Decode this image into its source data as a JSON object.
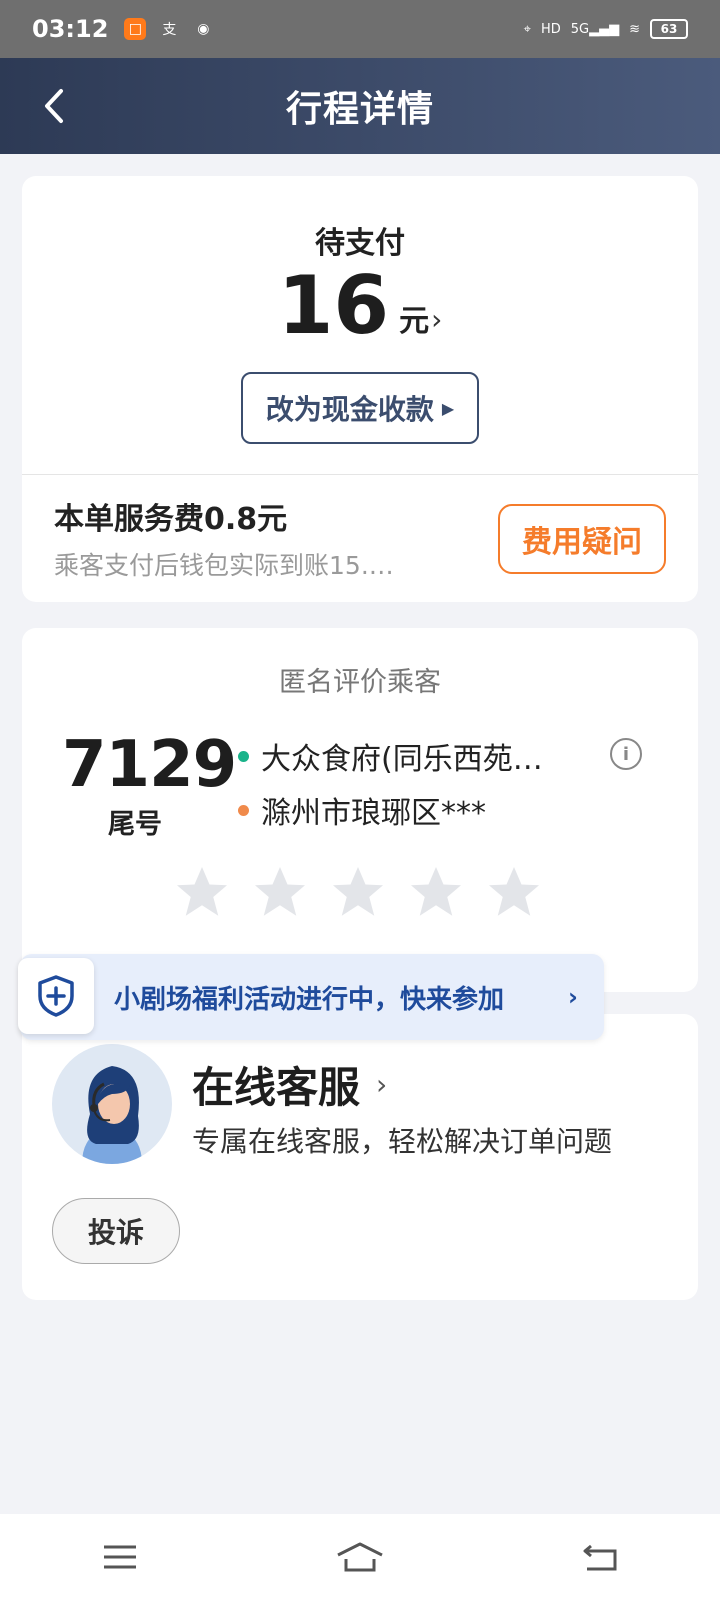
{
  "status_bar": {
    "time": "03:12",
    "left_icons": [
      "orange-app-icon",
      "alipay-icon",
      "chat-icon"
    ],
    "network": "5G",
    "hd": "HD",
    "battery": "63"
  },
  "header": {
    "title": "行程详情"
  },
  "payment": {
    "status": "待支付",
    "amount": "16",
    "unit": "元",
    "cash_button": "改为现金收款",
    "fee_title": "本单服务费0.8元",
    "fee_subtitle": "乘客支付后钱包实际到账15.…",
    "fee_question_button": "费用疑问"
  },
  "rating": {
    "title": "匿名评价乘客",
    "tail_number": "7129",
    "tail_label": "尾号",
    "from": "大众食府(同乐西苑…",
    "to": "滁州市琅琊区***",
    "stars_selected": 0,
    "stars_total": 5
  },
  "promo": {
    "text": "小剧场福利活动进行中，快来参加"
  },
  "service": {
    "title": "在线客服",
    "subtitle": "专属在线客服，轻松解决订单问题",
    "complain_button": "投诉"
  },
  "colors": {
    "accent_orange": "#f57c2b",
    "navy": "#3b4d6e",
    "promo_blue": "#1f4b9c",
    "star_gray": "#e3e5e9"
  }
}
